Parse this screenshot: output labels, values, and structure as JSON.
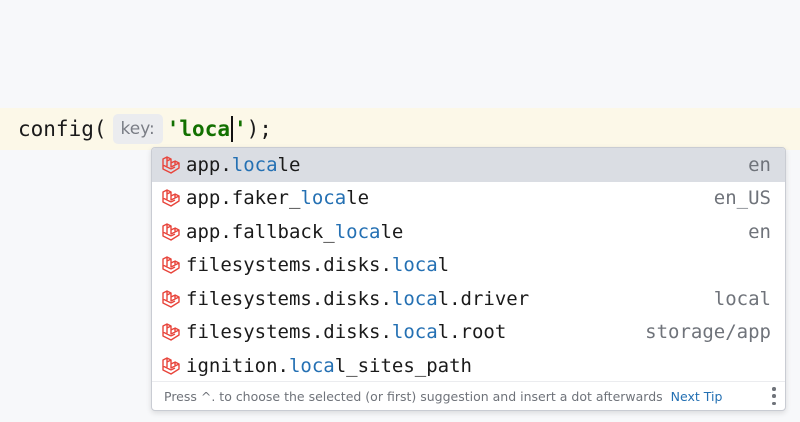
{
  "editor": {
    "function_name": "config(",
    "param_hint": "key:",
    "string_typed": "'loca",
    "string_close": "'",
    "line_end": ");"
  },
  "completion": {
    "items": [
      {
        "prefix": "app.",
        "match": "loca",
        "suffix": "le",
        "value": "en"
      },
      {
        "prefix": "app.faker_",
        "match": "loca",
        "suffix": "le",
        "value": "en_US"
      },
      {
        "prefix": "app.fallback_",
        "match": "loca",
        "suffix": "le",
        "value": "en"
      },
      {
        "prefix": "filesystems.disks.",
        "match": "loca",
        "suffix": "l",
        "value": ""
      },
      {
        "prefix": "filesystems.disks.",
        "match": "loca",
        "suffix": "l.driver",
        "value": "local"
      },
      {
        "prefix": "filesystems.disks.",
        "match": "loca",
        "suffix": "l.root",
        "value": "storage/app"
      },
      {
        "prefix": "ignition.",
        "match": "loca",
        "suffix": "l_sites_path",
        "value": ""
      }
    ],
    "selected_index": 0,
    "item_icon": "laravel-icon",
    "footer_tip": "Press ^. to choose the selected (or first) suggestion and insert a dot afterwards",
    "next_tip_label": "Next Tip",
    "menu_icon": "vertical-ellipsis-icon"
  },
  "colors": {
    "laravel": "#e8453c",
    "match_highlight": "#2470b3",
    "string": "#127000"
  }
}
